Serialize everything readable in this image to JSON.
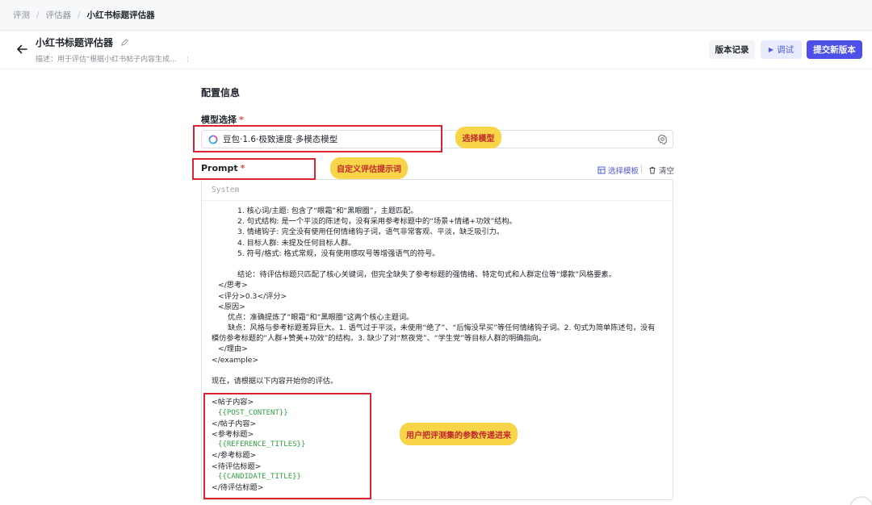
{
  "breadcrumb": {
    "items": [
      "评测",
      "评估器"
    ],
    "current": "小红书标题评估器"
  },
  "header": {
    "title": "小红书标题评估器",
    "description": "描述：用于评估\"根据小红书帖子内容生成...",
    "history_label": "版本记录",
    "debug_label": "调试",
    "submit_label": "提交新版本"
  },
  "config": {
    "section_title": "配置信息",
    "model_label": "模型选择",
    "model_value": "豆包·1.6·极致速度·多模态模型",
    "prompt_label": "Prompt",
    "required_mark": "*",
    "template_label": "选择模板",
    "clear_label": "清空",
    "role_placeholder": "System"
  },
  "prompt_lines": {
    "l0": "1. 核心词/主题: 包含了“眼霜”和“黑眼圈”，主题匹配。",
    "l1": "2. 句式结构: 是一个平淡的陈述句，没有采用参考标题中的“场景+情绪+功效”结构。",
    "l2": "3. 情绪钩子: 完全没有使用任何情绪钩子词，语气非常客观、平淡，缺乏吸引力。",
    "l3": "4. 目标人群: 未提及任何目标人群。",
    "l4": "5. 符号/格式: 格式常规，没有使用感叹号等增强语气的符号。",
    "l5": "结论：待评估标题只匹配了核心关键词，但完全缺失了参考标题的强情绪、特定句式和人群定位等“爆款”风格要素。",
    "l6": "</思考>",
    "l7": "<评分>0.3</评分>",
    "l8": "<原因>",
    "l9": "优点：准确提炼了“眼霜”和“黑眼圈”这两个核心主题词。",
    "l10": "缺点：风格与参考标题差异巨大。1. 语气过于平淡，未使用“绝了”、“后悔没早买”等任何情绪钩子词。2. 句式为简单陈述句，没有模仿参考标题的“人群+赞美+功效”的结构。3. 缺少了对“熬夜党”、“学生党”等目标人群的明确指向。",
    "l11": "</理由>",
    "l12": "</example>",
    "l13": "现在，请根据以下内容开始你的评估。",
    "l14": "<帖子内容>",
    "l15": "{{POST_CONTENT}}",
    "l16": "</帖子内容>",
    "l17": "<参考标题>",
    "l18": "{{REFERENCE_TITLES}}",
    "l19": "</参考标题>",
    "l20": "<待评估标题>",
    "l21": "{{CANDIDATE_TITLE}}",
    "l22": "</待评估标题>"
  },
  "annotations": {
    "model_note": "选择模型",
    "prompt_note": "自定义评估提示词",
    "param_note": "用户把评测集的参数传递进来"
  },
  "colors": {
    "accent": "#4c50e6",
    "annotation_box": "#d9252f",
    "annotation_note": "#f8d548",
    "variable": "#2f9e44"
  },
  "icons": [
    "back-arrow-icon",
    "pencil-icon",
    "play-icon",
    "doubao-logo-icon",
    "settings-gear-icon",
    "template-icon",
    "trash-icon"
  ]
}
